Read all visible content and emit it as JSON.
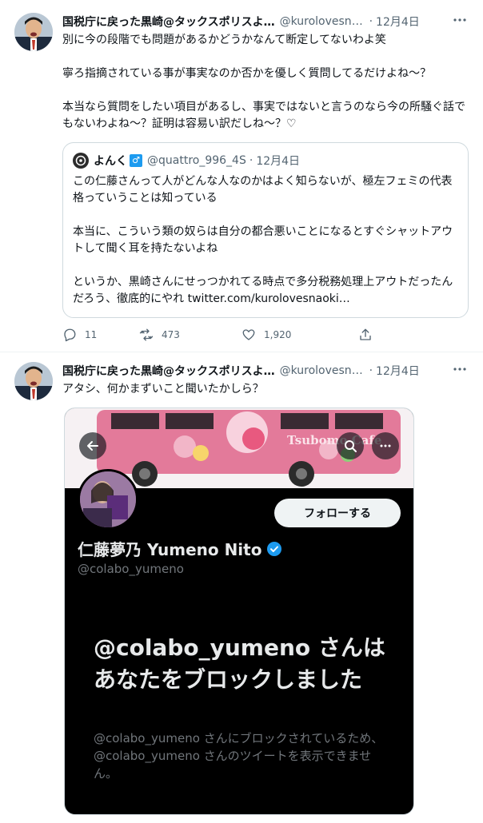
{
  "tweets": [
    {
      "author": "国税庁に戻った黒崎@タックスポリスよ…",
      "handle": "@kurolovesna…",
      "dot": "·",
      "time": "12月4日",
      "text": "別に今の段階でも問題があるかどうかなんて断定してないわよ笑\n\n寧ろ指摘されている事が事実なのか否かを優しく質問してるだけよね〜？\n\n本当なら質問をしたい項目があるし、事実ではないと言うのなら今の所騒ぐ話でもないわよね〜？証明は容易い訳だしね〜？♡",
      "quote": {
        "author": "よんく",
        "badge": "♂",
        "handle": "@quattro_996_4S",
        "dot": "·",
        "time": "12月4日",
        "text": "この仁藤さんって人がどんな人なのかはよく知らないが、極左フェミの代表格っていうことは知っている\n\n本当に、こういう類の奴らは自分の都合悪いことになるとすぐシャットアウトして聞く耳を持たないよね\n\nというか、黒崎さんにせっつかれてる時点で多分税務処理上アウトだったんだろう、徹底的にやれ twitter.com/kurolovesnaoki…"
      },
      "stats": {
        "replies": "11",
        "retweets": "473",
        "likes": "1,920"
      }
    },
    {
      "author": "国税庁に戻った黒崎@タックスポリスよ…",
      "handle": "@kurolovesna…",
      "dot": "·",
      "time": "12月4日",
      "text": "アタシ、何かまずいこと聞いたかしら？",
      "media": {
        "banner_text": "Tsubomo Cafe",
        "follow_label": "フォローする",
        "profile_name": "仁藤夢乃 Yumeno Nito",
        "profile_handle": "@colabo_yumeno",
        "block_title": "@colabo_yumeno さんはあなたをブロックしました",
        "block_desc": "@colabo_yumeno さんにブロックされているため、@colabo_yumeno さんのツイートを表示できません。"
      }
    }
  ],
  "icons": {
    "more": "more-icon",
    "reply": "reply-icon",
    "retweet": "retweet-icon",
    "like": "heart-icon",
    "share": "share-icon",
    "back": "back-arrow-icon",
    "search": "search-icon",
    "verified": "verified-badge-icon"
  },
  "colors": {
    "accent": "#1d9bf0",
    "text_secondary": "#536471",
    "media_bg": "#000000",
    "bus_pink": "#e37a9a"
  }
}
